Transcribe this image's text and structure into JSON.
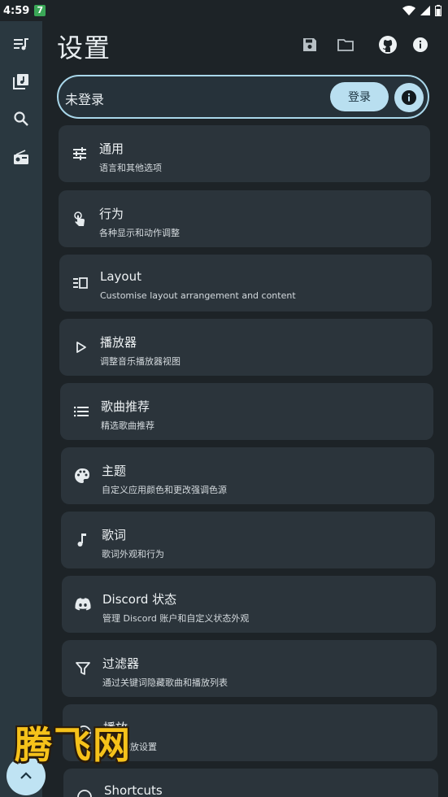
{
  "status_bar": {
    "time": "4:59",
    "badge": "7"
  },
  "header": {
    "title": "设置"
  },
  "account": {
    "status": "未登录",
    "login_label": "登录"
  },
  "settings_items": [
    {
      "title": "通用",
      "subtitle": "语言和其他选项",
      "icon": "tune-icon"
    },
    {
      "title": "行为",
      "subtitle": "各种显示和动作调整",
      "icon": "touch-icon"
    },
    {
      "title": "Layout",
      "subtitle": "Customise layout arrangement and content",
      "icon": "layout-icon"
    },
    {
      "title": "播放器",
      "subtitle": "调整音乐播放器视图",
      "icon": "play-icon"
    },
    {
      "title": "歌曲推荐",
      "subtitle": "精选歌曲推荐",
      "icon": "list-icon"
    },
    {
      "title": "主题",
      "subtitle": "自定义应用颜色和更改强调色源",
      "icon": "palette-icon"
    },
    {
      "title": "歌词",
      "subtitle": "歌词外观和行为",
      "icon": "music-note-icon"
    },
    {
      "title": "Discord 状态",
      "subtitle": "管理 Discord 账户和自定义状态外观",
      "icon": "discord-icon"
    },
    {
      "title": "过滤器",
      "subtitle": "通过关键词隐藏歌曲和播放列表",
      "icon": "filter-icon"
    },
    {
      "title": "播放",
      "subtitle": "音频播放设置",
      "icon": "playback-icon"
    },
    {
      "title": "Shortcuts",
      "subtitle": "",
      "icon": "shortcuts-icon"
    }
  ],
  "watermark": "腾飞网",
  "colors": {
    "background": "#1d2327",
    "card": "#2b343b",
    "rail": "#2a3840",
    "accent": "#b9dff0"
  }
}
